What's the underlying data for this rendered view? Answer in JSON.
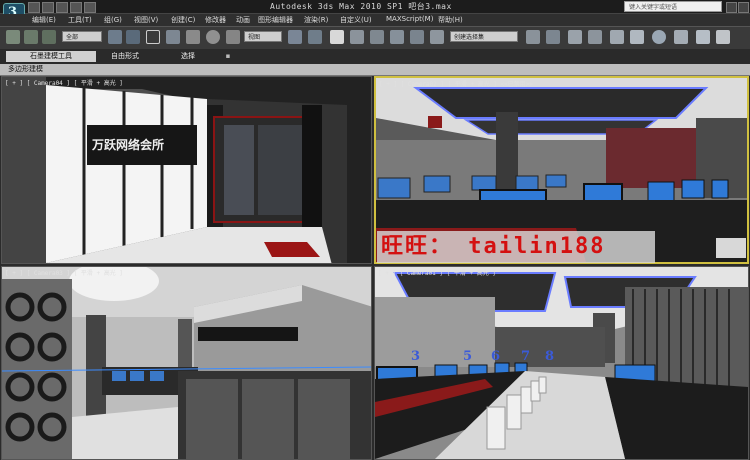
{
  "app": {
    "title": "Autodesk 3ds Max  2010 SP1    吧台3.max",
    "logo_letter": "3",
    "search_placeholder": "键入关键字或短语"
  },
  "menu": [
    "编辑(E)",
    "工具(T)",
    "组(G)",
    "视图(V)",
    "创建(C)",
    "修改器",
    "动画",
    "图形编辑器",
    "渲染(R)",
    "自定义(U)",
    "MAXScript(M)",
    "帮助(H)"
  ],
  "toolbar": {
    "filter_dropdown": "全部",
    "view_dropdown": "视图",
    "selection_set_dropdown": "创建选择集"
  },
  "ribbon": {
    "tabs": [
      "石墨建模工具",
      "自由形式",
      "选择"
    ]
  },
  "subbar": {
    "label": "多边形建模"
  },
  "viewports": [
    {
      "label": "[ + ] [ Camera04 ] [ 平滑 + 高光 ]"
    },
    {
      "label": "[ + ] [ Camera02 ] [ 平滑 + 高光 ] <<已禁用>>"
    },
    {
      "label": "[ + ] [ Camera03 ] [ 平滑 + 高光 ]"
    },
    {
      "label": "[ + ] [ Camera01 ] [ 平滑 + 高光 ]"
    }
  ],
  "scene": {
    "sign_text": "万跃网络会所",
    "seat_numbers": [
      "3",
      "5",
      "6",
      "7",
      "8"
    ]
  },
  "watermark": "旺旺： tailin188"
}
